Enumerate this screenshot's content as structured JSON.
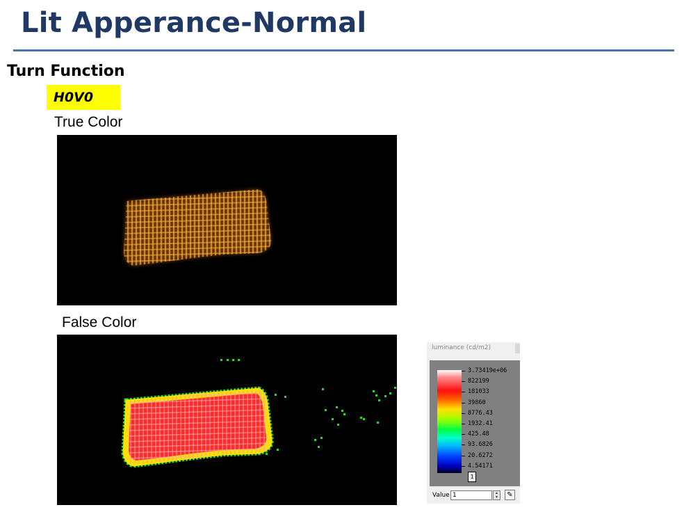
{
  "header": {
    "title": "Lit Apperance-Normal"
  },
  "section": {
    "heading": "Turn Function",
    "position_tag": "H0V0"
  },
  "true_color": {
    "label": "True Color"
  },
  "false_color": {
    "label": "False Color"
  },
  "legend": {
    "title": "luminance (cd/m2)",
    "values": [
      "3.73419e+06",
      "822199",
      "181033",
      "39860",
      "8776.43",
      "1932.41",
      "425.48",
      "93.6826",
      "20.6272",
      "4.54171"
    ],
    "min_value": "1",
    "value_label": "Value",
    "value_input": "1"
  },
  "colors": {
    "title": "#1f3864",
    "rule": "#4a76a8",
    "tag_highlight": "#ffff00",
    "amber": "#e07a10",
    "falsecolor_core": "#ff2a2a",
    "falsecolor_edge": "#ffe000",
    "falsecolor_outline": "#22dd22"
  },
  "icons": {
    "eyedropper": "eyedropper-icon",
    "spinner": "spinner-arrows-icon"
  }
}
